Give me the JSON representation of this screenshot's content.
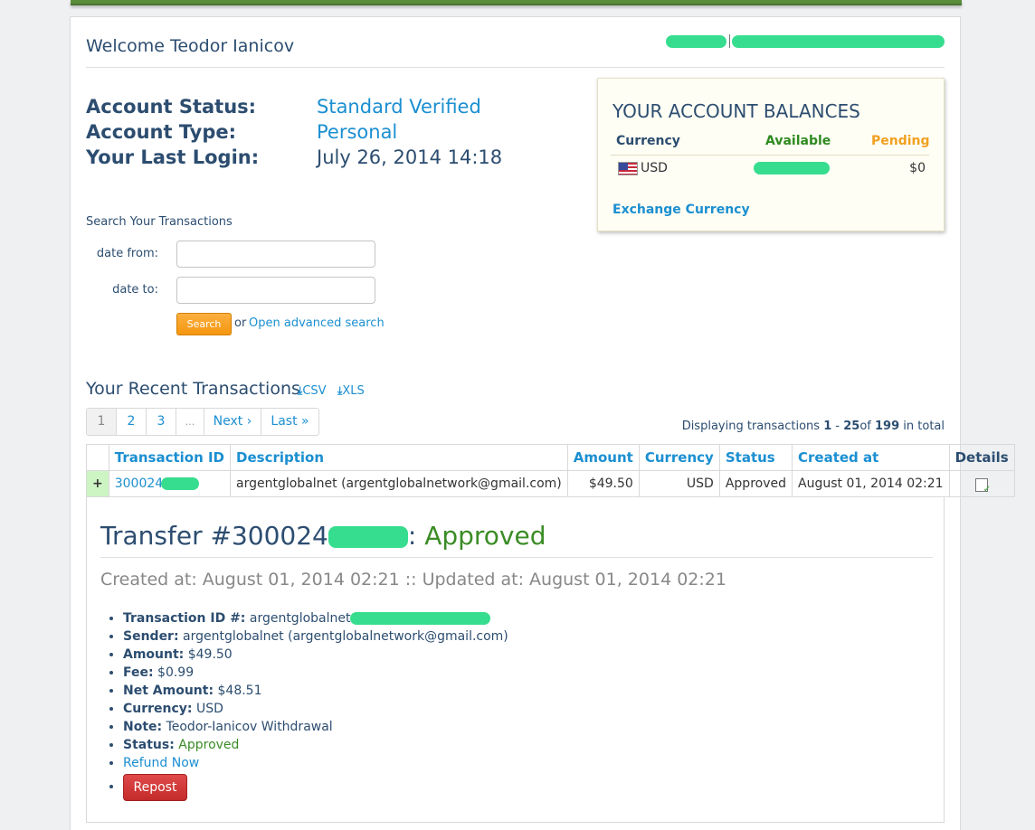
{
  "header": {
    "welcome": "Welcome Teodor Ianicov"
  },
  "account": {
    "status_label": "Account Status:",
    "status_value": "Standard Verified",
    "type_label": "Account Type:",
    "type_value": "Personal",
    "last_login_label": "Your Last Login:",
    "last_login_value": "July 26, 2014 14:18"
  },
  "balances": {
    "title": "YOUR ACCOUNT BALANCES",
    "col_currency": "Currency",
    "col_available": "Available",
    "col_pending": "Pending",
    "row_currency": "USD",
    "row_pending": "$0",
    "exchange_link": "Exchange Currency"
  },
  "search": {
    "title": "Search Your Transactions",
    "date_from_label": "date from:",
    "date_to_label": "date to:",
    "date_from_value": "",
    "date_to_value": "",
    "button": "Search",
    "or": "or",
    "advanced_link": "Open advanced search"
  },
  "recent": {
    "title": "Your Recent Transactions",
    "csv": "CSV",
    "xls": "XLS",
    "pager": [
      "1",
      "2",
      "3",
      "...",
      "Next ›",
      "Last »"
    ],
    "displaying_prefix": "Displaying transactions",
    "range_start": "1",
    "range_sep": "-",
    "range_end": "25",
    "of": "of",
    "total": "199",
    "in_total": "in total"
  },
  "table": {
    "headers": [
      "Transaction ID",
      "Description",
      "Amount",
      "Currency",
      "Status",
      "Created at",
      "Details"
    ],
    "row": {
      "expand": "+",
      "id": "300024",
      "description": "argentglobalnet (argentglobalnetwork@gmail.com)",
      "amount": "$49.50",
      "currency": "USD",
      "status": "Approved",
      "created": "August 01, 2014 02:21"
    }
  },
  "detail": {
    "title_prefix": "Transfer #300024",
    "title_sep": ":",
    "title_status": "Approved",
    "created_line": "Created at: August 01, 2014 02:21 :: Updated at: August 01, 2014 02:21",
    "transaction_id_label": "Transaction ID #:",
    "transaction_id_value": "argentglobalnet",
    "sender_label": "Sender:",
    "sender_value": "argentglobalnet (argentglobalnetwork@gmail.com)",
    "amount_label": "Amount:",
    "amount_value": "$49.50",
    "fee_label": "Fee:",
    "fee_value": "$0.99",
    "net_label": "Net Amount:",
    "net_value": "$48.51",
    "currency_label": "Currency:",
    "currency_value": "USD",
    "note_label": "Note:",
    "note_value": "Teodor-Ianicov Withdrawal",
    "status_label": "Status:",
    "status_value": "Approved",
    "refund_link": "Refund Now",
    "repost_button": "Repost"
  },
  "icons": {
    "download": "download-icon",
    "flag": "us-flag-icon",
    "details": "details-icon"
  },
  "colors": {
    "link": "#1b8fd1",
    "approved": "#3a8c25",
    "pending": "#f0a020",
    "available": "#2d8a1f",
    "search_button": "#f5960f",
    "repost_button": "#c42a2a",
    "redaction": "#37dd8f"
  }
}
